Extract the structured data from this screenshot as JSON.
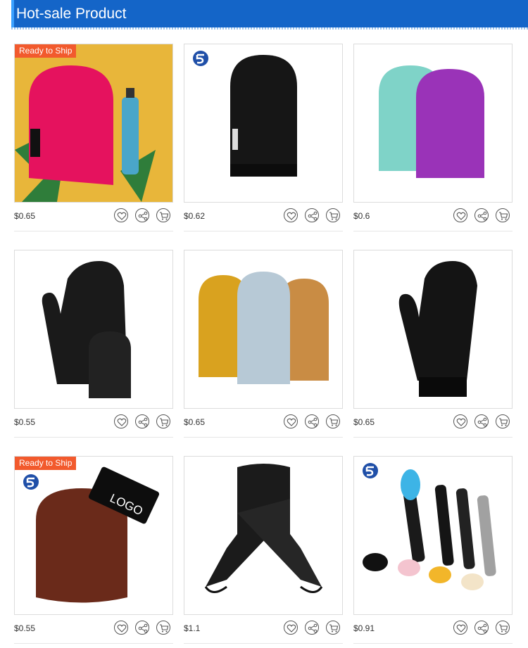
{
  "header": {
    "title": "Hot-sale Product"
  },
  "products": [
    {
      "price": "$0.65",
      "badge": "Ready to Ship",
      "brand": "",
      "image": "pink tanning mitt with spray bottle on yellow"
    },
    {
      "price": "$0.62",
      "badge": "",
      "brand": "SPONDA",
      "image": "black tanning mitt"
    },
    {
      "price": "$0.6",
      "badge": "",
      "brand": "",
      "image": "teal and purple tanning mitts"
    },
    {
      "price": "$0.55",
      "badge": "",
      "brand": "",
      "image": "black mitt with small mitt"
    },
    {
      "price": "$0.65",
      "badge": "",
      "brand": "",
      "image": "gold, holographic and bronze glitter mitts"
    },
    {
      "price": "$0.65",
      "badge": "",
      "brand": "",
      "image": "black tanning mitt with cuff"
    },
    {
      "price": "$0.55",
      "badge": "Ready to Ship",
      "brand": "SPONDA",
      "logo_text": "LOGO",
      "image": "brown exfoliating mitt with LOGO band"
    },
    {
      "price": "$1.1",
      "badge": "",
      "brand": "",
      "image": "black back applicator strap"
    },
    {
      "price": "$0.91",
      "badge": "",
      "brand": "SPONDA",
      "image": "back lotion applicators"
    }
  ],
  "icons": [
    "heart-icon",
    "share-icon",
    "cart-icon"
  ]
}
